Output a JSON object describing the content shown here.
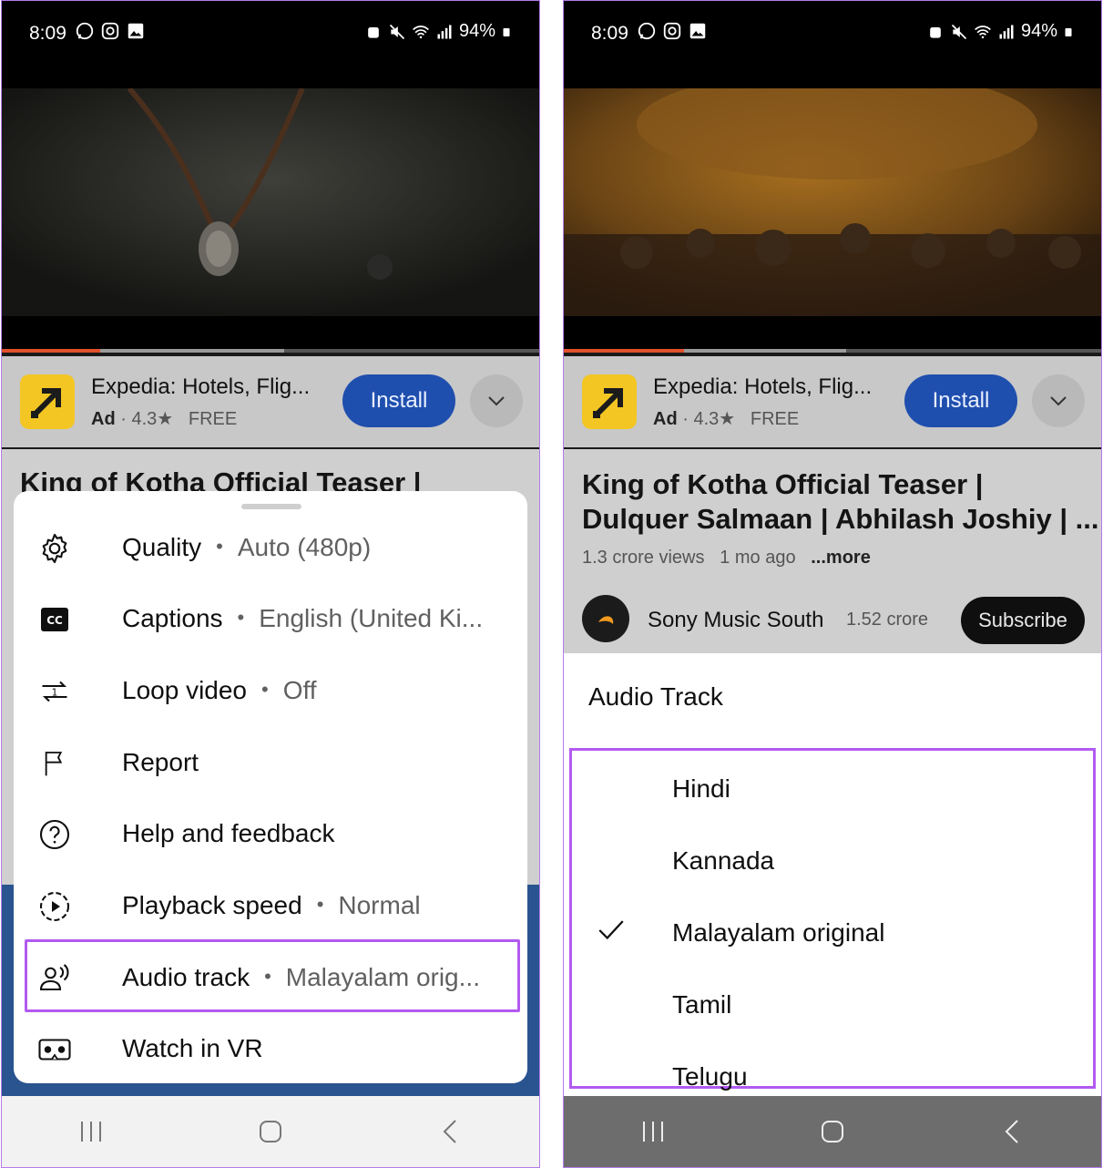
{
  "status_bar": {
    "time": "8:09",
    "battery": "94%"
  },
  "ad": {
    "title": "Expedia: Hotels, Flig...",
    "ad_label": "Ad",
    "rating": "4.3",
    "price": "FREE",
    "install_label": "Install"
  },
  "video_info": {
    "title_left": "King of Kotha Official Teaser |",
    "title_line1": "King of Kotha Official Teaser |",
    "title_line2": "Dulquer Salmaan | Abhilash Joshiy | ...",
    "views": "1.3 crore views",
    "age": "1 mo ago",
    "more": "...more",
    "channel": "Sony Music South",
    "subscribers": "1.52 crore",
    "subscribe_label": "Subscribe"
  },
  "settings_menu": {
    "items": [
      {
        "label": "Quality",
        "value": "Auto (480p)",
        "icon": "gear-icon"
      },
      {
        "label": "Captions",
        "value": "English (United Ki...",
        "icon": "captions-icon"
      },
      {
        "label": "Loop video",
        "value": "Off",
        "icon": "loop-icon"
      },
      {
        "label": "Report",
        "value": "",
        "icon": "flag-icon"
      },
      {
        "label": "Help and feedback",
        "value": "",
        "icon": "help-icon"
      },
      {
        "label": "Playback speed",
        "value": "Normal",
        "icon": "playback-speed-icon"
      },
      {
        "label": "Audio track",
        "value": "Malayalam orig...",
        "icon": "audio-track-icon"
      },
      {
        "label": "Watch in VR",
        "value": "",
        "icon": "vr-icon"
      }
    ]
  },
  "audio_track_sheet": {
    "title": "Audio Track",
    "tracks": [
      {
        "name": "Hindi",
        "selected": false
      },
      {
        "name": "Kannada",
        "selected": false
      },
      {
        "name": "Malayalam original",
        "selected": true
      },
      {
        "name": "Tamil",
        "selected": false
      },
      {
        "name": "Telugu",
        "selected": false
      }
    ]
  },
  "colors": {
    "highlight": "#b25af0",
    "install": "#1f4fae",
    "progress": "#e0502a"
  }
}
